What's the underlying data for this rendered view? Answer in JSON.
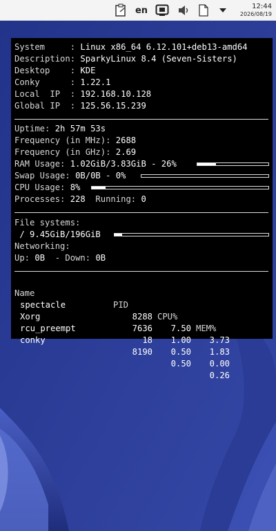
{
  "panel": {
    "lang": "en",
    "clock_time": "12:44",
    "clock_date": "2026/08/19",
    "icons": [
      "clipboard-icon",
      "snapshot-icon",
      "volume-icon",
      "notes-icon",
      "tray-arrow-icon"
    ]
  },
  "conky": {
    "system": [
      {
        "label": "System     :",
        "value": "Linux x86_64 6.12.101+deb13-amd64"
      },
      {
        "label": "Description:",
        "value": "SparkyLinux 8.4 (Seven-Sisters)"
      },
      {
        "label": "Desktop    :",
        "value": "KDE"
      },
      {
        "label": "Conky      :",
        "value": "1.22.1"
      },
      {
        "label": "Local  IP  :",
        "value": "192.168.10.128"
      },
      {
        "label": "Global IP  :",
        "value": "125.56.15.239"
      }
    ],
    "uptime_label": "Uptime:",
    "uptime": "2h 57m 53s",
    "freq_mhz_label": "Frequency (in MHz):",
    "freq_mhz": "2688",
    "freq_ghz_label": "Frequency (in GHz):",
    "freq_ghz": "2.69",
    "ram_label": "RAM Usage:",
    "ram": "1.02GiB/3.83GiB - 26%",
    "ram_percent": 26,
    "swap_label": "Swap Usage:",
    "swap": "0B/0B - 0%",
    "swap_percent": 0,
    "cpu_label": "CPU Usage:",
    "cpu": "8%",
    "cpu_percent": 8,
    "processes_label": "Processes:",
    "processes": "228",
    "running_label": "Running:",
    "running": "0",
    "fs_label": "File systems:",
    "fs_mount": "/",
    "fs_usage": "9.45GiB/196GiB",
    "fs_percent": 5,
    "net_label": "Networking:",
    "up_label": "Up:",
    "up": "0B",
    "down_label": "- Down:",
    "down": "0B",
    "proc_headers": {
      "name": "Name",
      "pid": "PID",
      "cpu": "CPU%",
      "mem": "MEM%"
    },
    "proc_rows": [
      {
        "name": "spectacle",
        "pid": "8288",
        "cpu": "7.50",
        "mem": "3.73"
      },
      {
        "name": "Xorg",
        "pid": "7636",
        "cpu": "1.00",
        "mem": "1.83"
      },
      {
        "name": "rcu_preempt",
        "pid": "18",
        "cpu": "0.50",
        "mem": "0.00"
      },
      {
        "name": "conky",
        "pid": "8190",
        "cpu": "0.50",
        "mem": "0.26"
      }
    ]
  }
}
